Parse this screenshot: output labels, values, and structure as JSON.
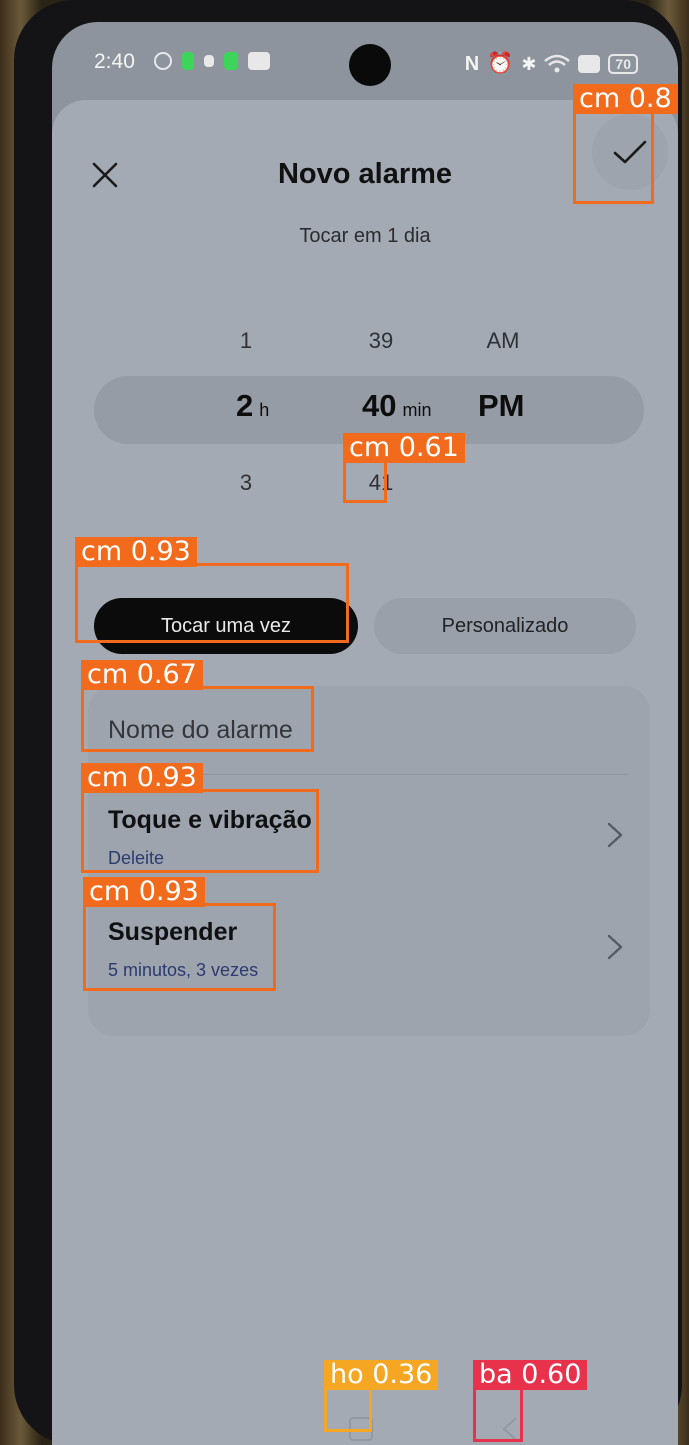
{
  "status_bar": {
    "time": "2:40",
    "battery": "70",
    "left_icons": [
      "steering-icon",
      "signal-icon",
      "notification-icon",
      "signal-icon",
      "message-icon"
    ],
    "right_icons": [
      "nfc-icon",
      "alarm-icon",
      "bluetooth-icon",
      "wifi-icon",
      "screen-icon"
    ]
  },
  "header": {
    "title": "Novo alarme",
    "subtitle": "Tocar em 1 dia"
  },
  "picker": {
    "hours": {
      "above": "1",
      "selected": "2",
      "below": "3",
      "unit": "h"
    },
    "minutes": {
      "above": "39",
      "selected": "40",
      "below": "41",
      "unit": "min"
    },
    "period": {
      "above": "AM",
      "selected": "PM"
    }
  },
  "mode": {
    "once_label": "Tocar uma vez",
    "custom_label": "Personalizado",
    "selected": "once"
  },
  "settings": {
    "name_placeholder": "Nome do alarme",
    "ringtone": {
      "title": "Toque e vibração",
      "value": "Deleite"
    },
    "snooze": {
      "title": "Suspender",
      "value": "5 minutos, 3 vezes"
    }
  },
  "detections": {
    "confirm": "cm 0.8",
    "minute_below": "cm 0.61",
    "once": "cm 0.93",
    "name": "cm 0.67",
    "ringtone": "cm 0.93",
    "snooze": "cm 0.93",
    "home": "ho 0.36",
    "back": "ba 0.60"
  },
  "colors": {
    "accent_dark": "#0b0b0b",
    "link_blue": "#2c3a70",
    "detection_orange": "#f26b1d",
    "detection_yellow": "#f5a623",
    "detection_red": "#e8324b"
  }
}
